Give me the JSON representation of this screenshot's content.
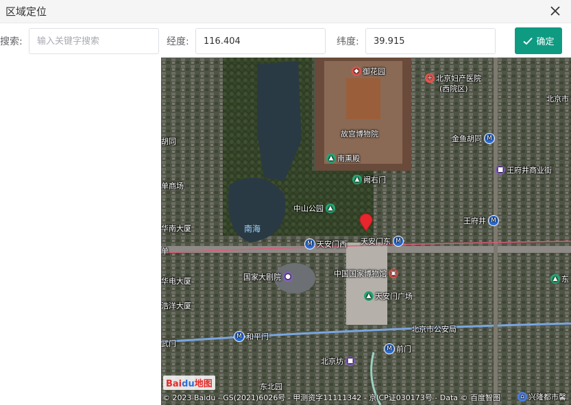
{
  "window": {
    "title": "区域定位",
    "close_icon": "close-icon"
  },
  "search": {
    "label": "搜索:",
    "placeholder": "输入关键字搜索",
    "value": ""
  },
  "longitude": {
    "label": "经度:",
    "value": "116.404"
  },
  "latitude": {
    "label": "纬度:",
    "value": "39.915"
  },
  "confirm": {
    "label": "确定",
    "icon": "check-icon",
    "color": "#0f9b82"
  },
  "map": {
    "marker_color": "#e8262d",
    "places": {
      "yuhuayuan": "御花园",
      "beijing_fuchan": "北京妇产医院",
      "beijing_fuchan_sub": "(西院区)",
      "beijingshi": "北京市",
      "gugong": "故宫博物院",
      "jinyu_hutong": "金鱼胡同",
      "nanxundian": "南熏殿",
      "wangfujing_mall": "王府井商业街",
      "queyoumen": "阙右门",
      "zhongshan_park": "中山公园",
      "nanhai": "南海",
      "wangfujing": "王府井",
      "tiananmen_west": "天安门西",
      "tiananmen_east": "天安门东",
      "national_theater": "国家大剧院",
      "national_museum": "中国国家博物馆",
      "tiananmen_square": "天安门广场",
      "public_security": "北京市公安局",
      "hepingmen": "和平门",
      "qianmen": "前门",
      "beijingfang": "北京坊",
      "dongbeiyuan": "东北园",
      "xinglong": "兴隆都市馨",
      "left_hutong": "胡同",
      "left_mall": "单商场",
      "left_nanda": "华南大厦",
      "left_dan": "单",
      "left_huadian": "华电大厦",
      "left_haoyang": "浩洋大厦",
      "left_wumen": "武门",
      "right_dong": "东"
    },
    "logo_text_a": "Bai",
    "logo_text_b": "du",
    "logo_text_c": "地图",
    "copyright": "© 2023 Baidu - GS(2021)6026号 - 甲测资字11111342 - 京ICP证030173号 - Data © 百度智图"
  }
}
